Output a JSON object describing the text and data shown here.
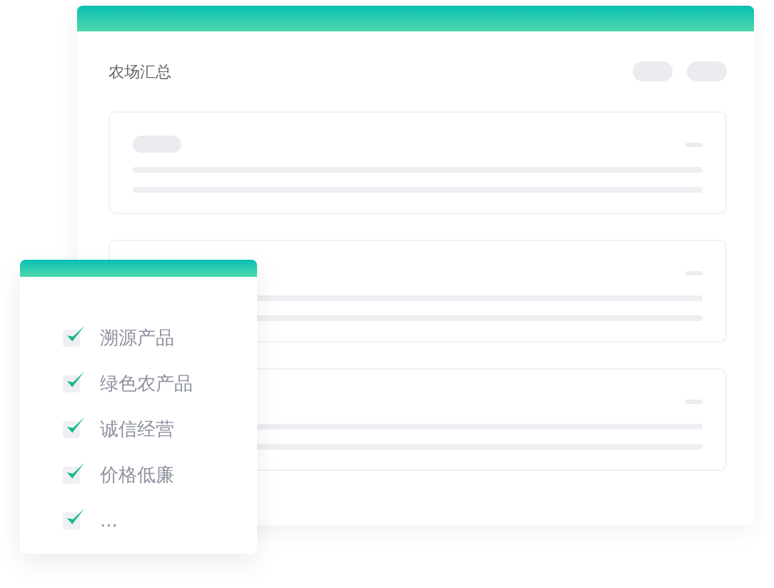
{
  "main_window": {
    "title": "农场汇总"
  },
  "feature_list": {
    "items": [
      {
        "label": "溯源产品",
        "checked": true
      },
      {
        "label": "绿色农产品",
        "checked": true
      },
      {
        "label": "诚信经营",
        "checked": true
      },
      {
        "label": "价格低廉",
        "checked": true
      },
      {
        "label": "...",
        "checked": true
      }
    ]
  }
}
